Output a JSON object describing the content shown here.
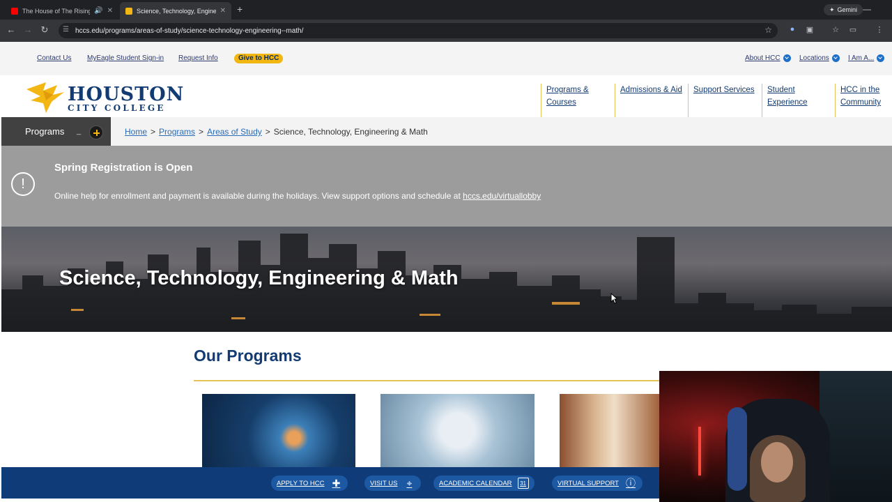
{
  "browser": {
    "tabs": [
      {
        "title": "The House of The Rising Su",
        "active": false,
        "favicon_color": "#ff0000"
      },
      {
        "title": "Science, Technology, Engineeri",
        "active": true,
        "favicon_color": "#f2b713"
      }
    ],
    "url": "hccs.edu/programs/areas-of-study/science-technology-engineering--math/",
    "gemini_label": "Gemini"
  },
  "utility_nav": {
    "left": [
      "Contact Us",
      "MyEagle Student Sign-in",
      "Request Info"
    ],
    "give_label": "Give to HCC",
    "right": [
      "About HCC",
      "Locations",
      "I Am A..."
    ]
  },
  "logo": {
    "line1": "HOUSTON",
    "line2": "CITY COLLEGE"
  },
  "main_nav": [
    {
      "line1": "Programs &",
      "line2": "Courses"
    },
    {
      "line1": "Admissions & Aid",
      "line2": ""
    },
    {
      "line1": "Support Services",
      "line2": ""
    },
    {
      "line1": "Student",
      "line2": "Experience"
    },
    {
      "line1": "HCC in the",
      "line2": "Community"
    }
  ],
  "programs_toggle": {
    "label": "Programs",
    "minus": "_"
  },
  "breadcrumb": {
    "links": [
      "Home",
      "Programs",
      "Areas of Study"
    ],
    "separator": ">",
    "current": "Science, Technology, Engineering & Math"
  },
  "alert": {
    "icon": "!",
    "title": "Spring Registration is Open",
    "text": "Online help for enrollment and payment is available during the holidays. View support options and schedule at",
    "link": "hccs.edu/virtuallobby"
  },
  "hero": {
    "title": "Science, Technology, Engineering & Math"
  },
  "programs": {
    "heading": "Our Programs"
  },
  "bottom_bar": [
    {
      "label": "APPLY TO HCC",
      "icon": "plus-icon"
    },
    {
      "label": "VISIT US",
      "icon": "map-pin-icon"
    },
    {
      "label": "ACADEMIC CALENDAR",
      "icon": "calendar-icon",
      "icon_text": "31"
    },
    {
      "label": "VIRTUAL SUPPORT",
      "icon": "info-icon"
    }
  ],
  "colors": {
    "brand_navy": "#123b73",
    "brand_gold": "#f2b713",
    "link_blue": "#2a6bb5"
  }
}
